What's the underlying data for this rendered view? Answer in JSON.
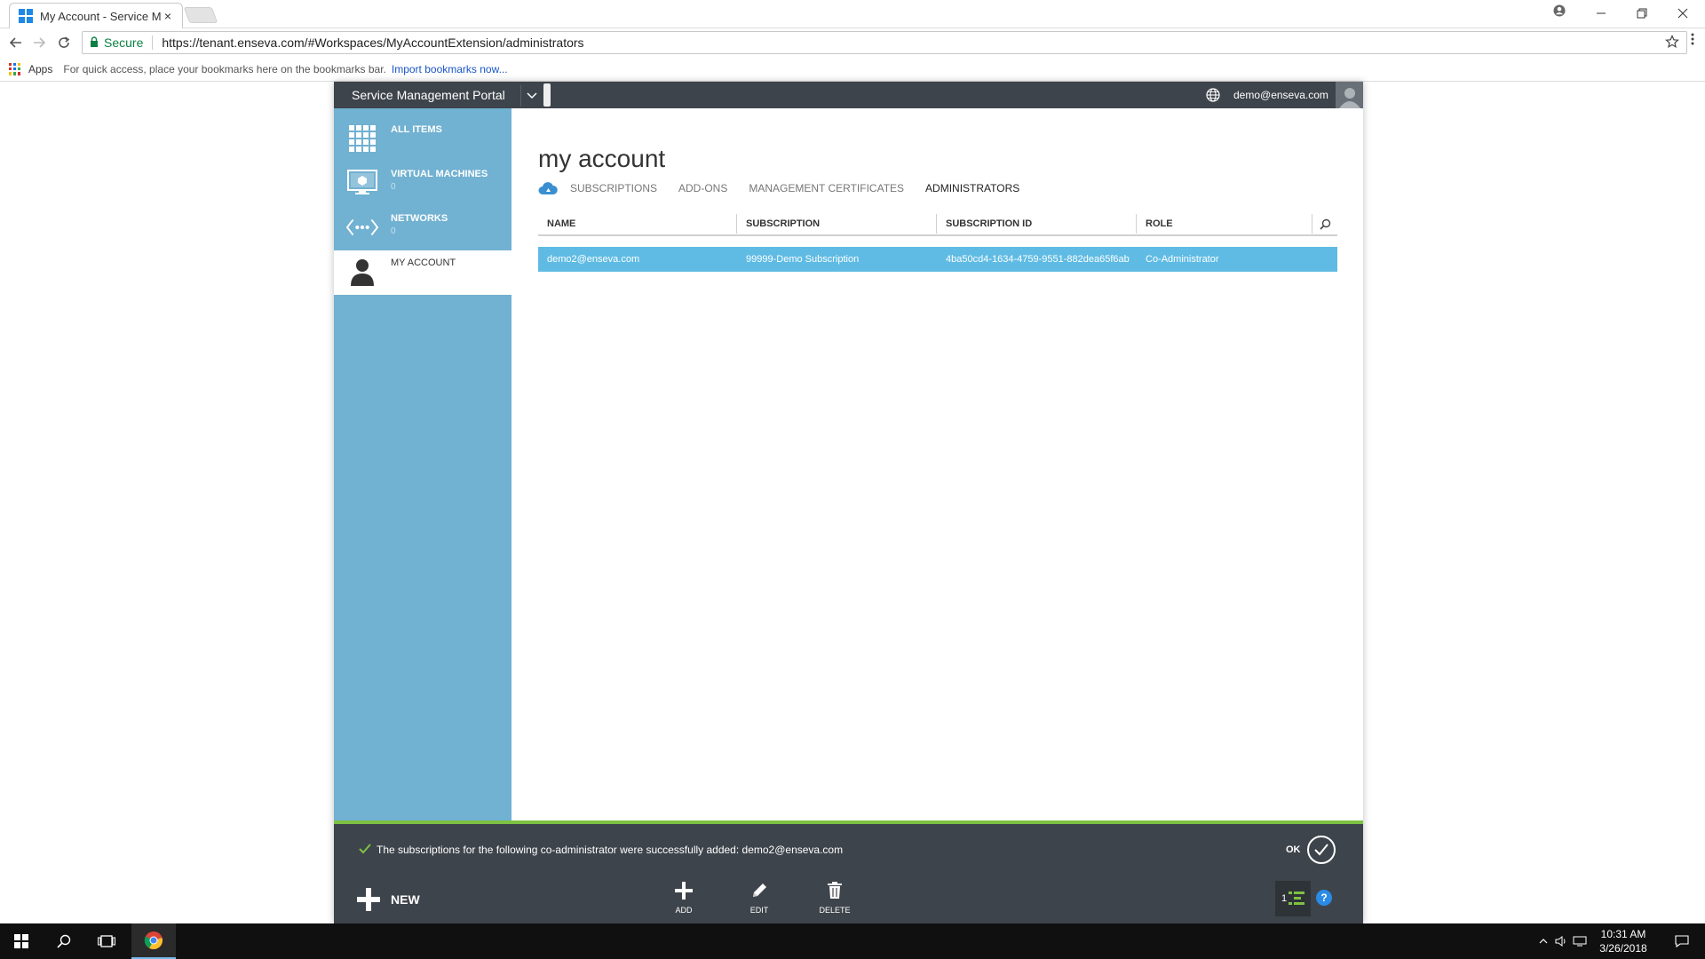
{
  "browser": {
    "tab_title": "My Account - Service Ma",
    "tab_close": "×",
    "address": {
      "secure_label": "Secure",
      "url": "https://tenant.enseva.com/#Workspaces/MyAccountExtension/administrators"
    },
    "bookmarks": {
      "apps_label": "Apps",
      "hint": "For quick access, place your bookmarks here on the bookmarks bar.",
      "import_link": "Import bookmarks now..."
    }
  },
  "portal": {
    "title": "Service Management Portal",
    "user_email": "demo@enseva.com",
    "nav": [
      {
        "label": "ALL ITEMS",
        "count": ""
      },
      {
        "label": "VIRTUAL MACHINES",
        "count": "0"
      },
      {
        "label": "NETWORKS",
        "count": "0"
      },
      {
        "label": "MY ACCOUNT",
        "count": ""
      }
    ],
    "page_title": "my account",
    "tabs": [
      "SUBSCRIPTIONS",
      "ADD-ONS",
      "MANAGEMENT CERTIFICATES",
      "ADMINISTRATORS"
    ],
    "grid": {
      "columns": [
        "NAME",
        "SUBSCRIPTION",
        "SUBSCRIPTION ID",
        "ROLE"
      ],
      "rows": [
        [
          "demo2@enseva.com",
          "99999-Demo Subscription",
          "4ba50cd4-1634-4759-9551-882dea65f6ab",
          "Co-Administrator"
        ]
      ]
    },
    "notification": {
      "message": "The subscriptions for the following co-administrator were successfully added: demo2@enseva.com",
      "ok_label": "OK"
    },
    "commands": {
      "new_label": "NEW",
      "add_label": "ADD",
      "edit_label": "EDIT",
      "delete_label": "DELETE",
      "tasks_count": "1",
      "help_label": "?"
    }
  },
  "taskbar": {
    "time": "10:31 AM",
    "date": "3/26/2018"
  },
  "colors": {
    "nav_blue": "#71b1d1",
    "row_highlight": "#5fbbe3",
    "header_dark": "#3e444b",
    "success_green": "#7dc242"
  }
}
